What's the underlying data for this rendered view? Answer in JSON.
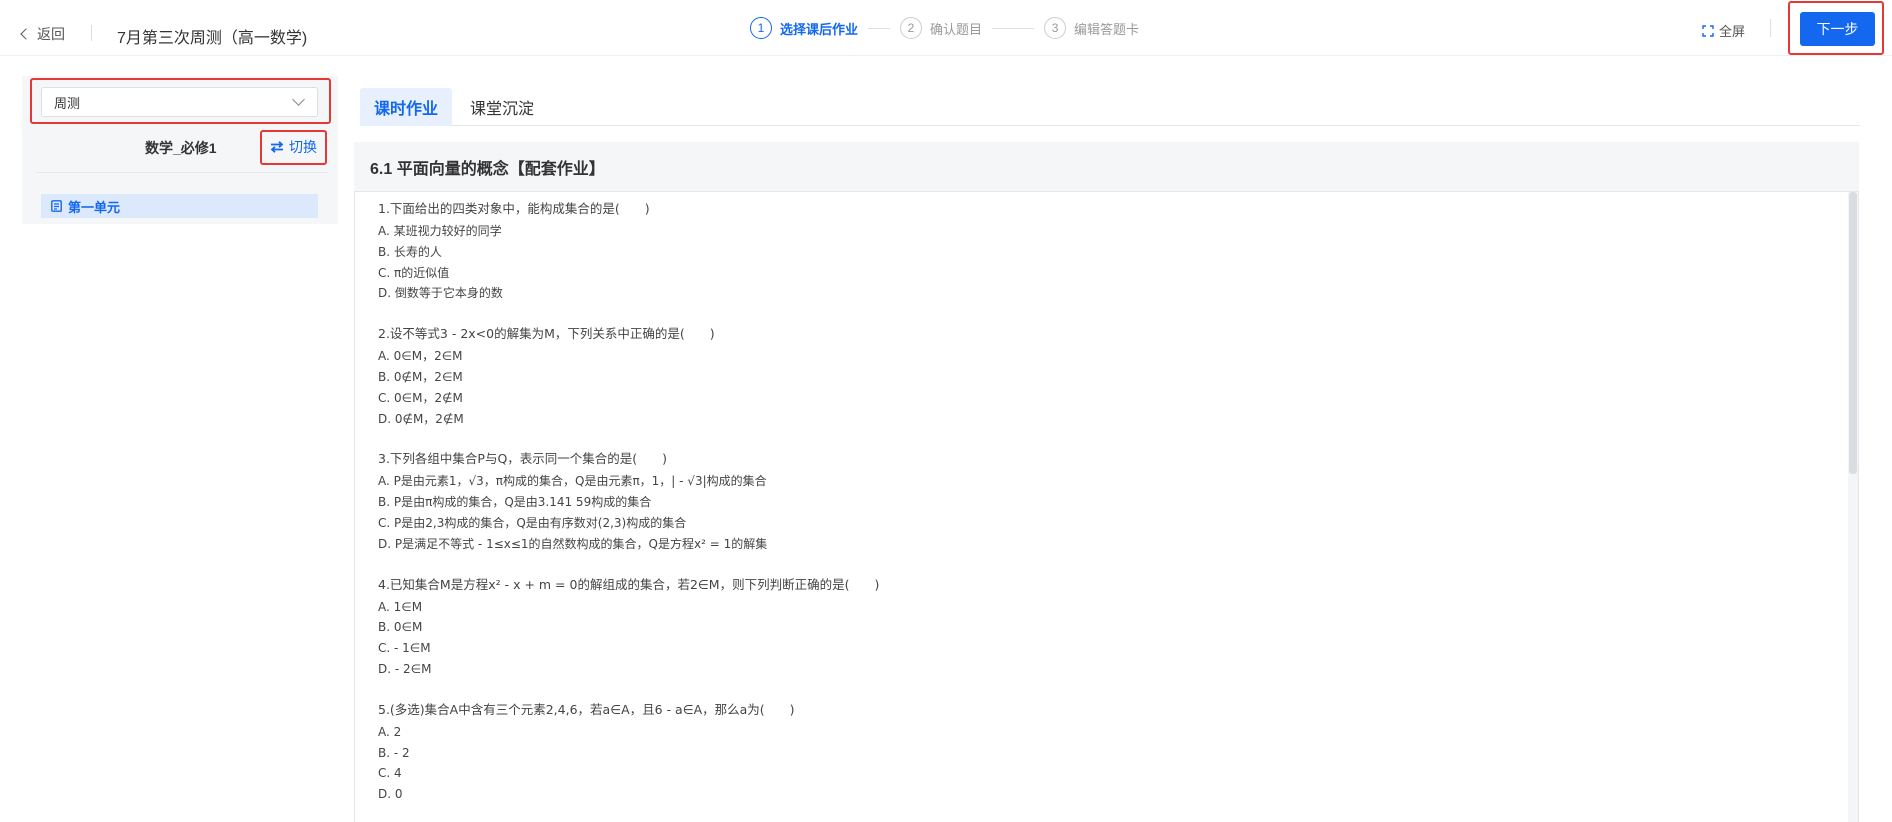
{
  "header": {
    "back_label": "返回",
    "title": "7月第三次周测（高一数学)",
    "steps": [
      {
        "num": "1",
        "label": "选择课后作业",
        "active": true
      },
      {
        "num": "2",
        "label": "确认题目",
        "active": false
      },
      {
        "num": "3",
        "label": "编辑答题卡",
        "active": false
      }
    ],
    "fullscreen_label": "全屏",
    "fullscreen_icon": "expand-icon",
    "next_label": "下一步"
  },
  "sidebar": {
    "select_value": "周测",
    "book_name": "数学_必修1",
    "switch_label": "切换",
    "switch_icon": "swap-icon",
    "units": [
      {
        "label": "第一单元",
        "icon": "document-icon",
        "selected": true
      }
    ]
  },
  "tabs": [
    {
      "label": "课时作业",
      "active": true
    },
    {
      "label": "课堂沉淀",
      "active": false
    }
  ],
  "section_title": "6.1 平面向量的概念【配套作业】",
  "questions": [
    {
      "stem": "1.下面给出的四类对象中，能构成集合的是(　　)",
      "options": [
        "A. 某班视力较好的同学",
        "B. 长寿的人",
        "C. π的近似值",
        "D. 倒数等于它本身的数"
      ]
    },
    {
      "stem": "2.设不等式3 - 2x<0的解集为M，下列关系中正确的是(　　)",
      "options": [
        "A. 0∈M，2∈M",
        "B. 0∉M，2∈M",
        "C. 0∈M，2∉M",
        "D. 0∉M，2∉M"
      ]
    },
    {
      "stem": "3.下列各组中集合P与Q，表示同一个集合的是(　　)",
      "options": [
        "A. P是由元素1，√3，π构成的集合，Q是由元素π，1，| - √3|构成的集合",
        "B. P是由π构成的集合，Q是由3.141 59构成的集合",
        "C. P是由2,3构成的集合，Q是由有序数对(2,3)构成的集合",
        "D. P是满足不等式 - 1≤x≤1的自然数构成的集合，Q是方程x² = 1的解集"
      ]
    },
    {
      "stem": "4.已知集合M是方程x² - x + m = 0的解组成的集合，若2∈M，则下列判断正确的是(　　)",
      "options": [
        "A. 1∈M",
        "B. 0∈M",
        "C.  - 1∈M",
        "D.  - 2∈M"
      ]
    },
    {
      "stem": "5.(多选)集合A中含有三个元素2,4,6，若a∈A，且6 - a∈A，那么a为(　　)",
      "options": [
        "A. 2",
        "B.  - 2",
        "C. 4",
        "D. 0"
      ]
    }
  ],
  "colors": {
    "accent": "#1468f0",
    "highlight_border": "#e53935",
    "panel_bg": "#f5f6f8",
    "selected_bg": "#dce9fc"
  }
}
